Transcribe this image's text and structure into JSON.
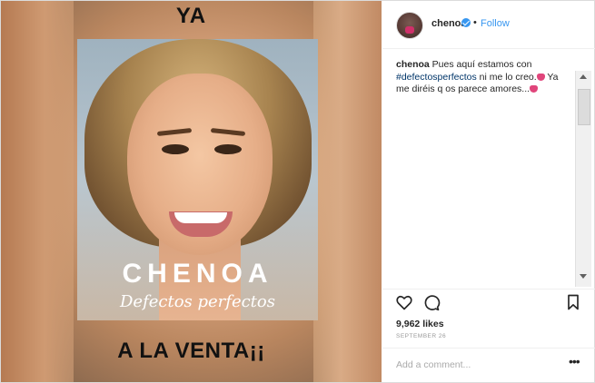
{
  "media": {
    "caption_top": "YA",
    "caption_bottom": "A LA VENTA¡¡",
    "book": {
      "author": "CHENOA",
      "title": "Defectos perfectos"
    }
  },
  "post": {
    "username": "chenoa",
    "follow_label": "Follow",
    "separator": "•",
    "caption_user": "chenoa",
    "caption_part1": " Pues aquí estamos con ",
    "hashtag": "#defectosperfectos",
    "caption_part2": " ni me lo creo.",
    "caption_part3": " Ya me diréis q os parece amores...",
    "likes": "9,962 likes",
    "date": "SEPTEMBER 26",
    "comment_placeholder": "Add a comment...",
    "more_label": "•••"
  },
  "icons": {
    "avatar": "avatar",
    "verified": "verified-badge-icon",
    "like": "heart-icon",
    "comment": "comment-bubble-icon",
    "save": "bookmark-icon",
    "more": "more-options-icon",
    "emoji": "kiss-emoji-icon"
  },
  "colors": {
    "link_blue": "#3897f0",
    "hashtag": "#003569",
    "text": "#262626",
    "muted": "#999999"
  }
}
